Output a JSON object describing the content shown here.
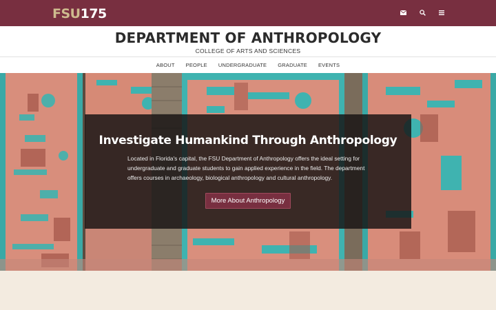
{
  "header": {
    "logo_fsu": "FSU",
    "logo_year": "175",
    "icons": [
      "mail-icon",
      "search-icon",
      "menu-icon"
    ]
  },
  "masthead": {
    "department": "DEPARTMENT OF ANTHROPOLOGY",
    "college": "COLLEGE OF ARTS AND SCIENCES"
  },
  "nav": {
    "items": [
      "ABOUT",
      "PEOPLE",
      "UNDERGRADUATE",
      "GRADUATE",
      "EVENTS"
    ]
  },
  "hero": {
    "title": "Investigate Humankind Through Anthropology",
    "body": "Located in Florida's capital, the FSU Department of Anthropology offers the ideal setting for undergraduate and graduate students to gain applied experience in the field. The department offers courses in archaeology, biological anthropology and cultural anthropology.",
    "button_label": "More About Anthropology"
  },
  "colors": {
    "garnet": "#782f40",
    "gold": "#cebb8e",
    "turquoise": "#3fb3b0",
    "terracotta": "#d98a78",
    "cream": "#f3ebe0"
  }
}
